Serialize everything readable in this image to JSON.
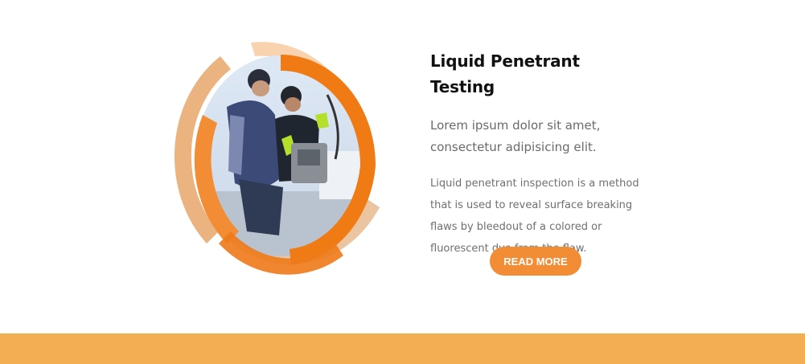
{
  "feature": {
    "title": "Liquid Penetrant Testing",
    "lead": "Lorem ipsum dolor sit amet, consectetur adipisicing elit.",
    "body": "Liquid penetrant inspection is a method that is used to reveal surface breaking flaws by bleedout of a colored or fluorescent dye from the flaw.",
    "cta_label": "READ MORE",
    "image_icon": "workers-inspection-photo"
  },
  "colors": {
    "accent": "#f28c35",
    "ring_light": "#e8a66a",
    "ring_dark": "#f07a14",
    "footer_band": "#f3ad52",
    "title": "#111111",
    "text": "#6f6f6f"
  }
}
